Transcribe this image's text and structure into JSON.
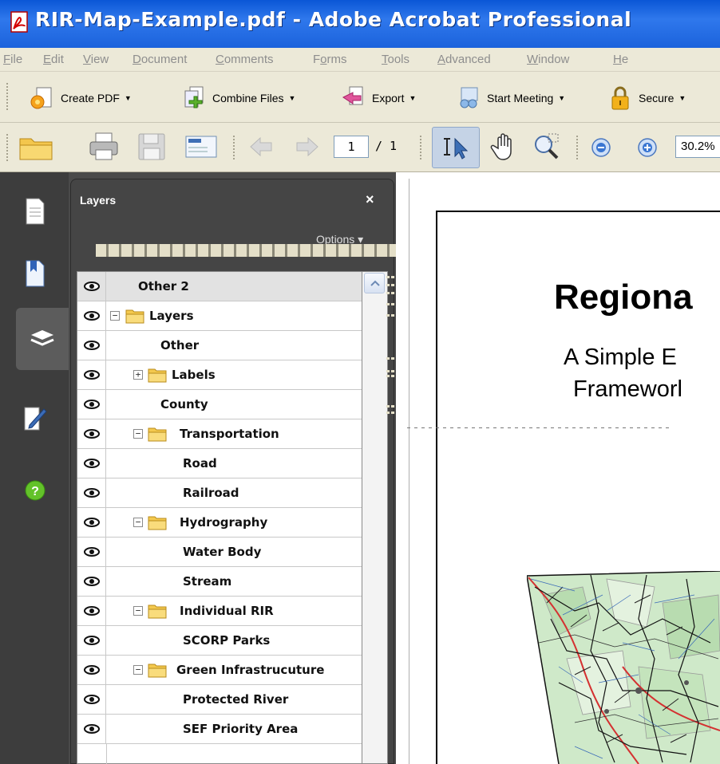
{
  "window": {
    "title": "RIR-Map-Example.pdf - Adobe Acrobat Professional"
  },
  "menu": [
    {
      "mn": "F",
      "rest": "ile"
    },
    {
      "mn": "E",
      "rest": "dit"
    },
    {
      "mn": "V",
      "rest": "iew"
    },
    {
      "mn": "D",
      "rest": "ocument"
    },
    {
      "mn": "C",
      "rest": "omments"
    },
    {
      "pre": "F",
      "mn": "o",
      "rest": "rms"
    },
    {
      "mn": "T",
      "rest": "ools"
    },
    {
      "mn": "A",
      "rest": "dvanced"
    },
    {
      "mn": "W",
      "rest": "indow"
    },
    {
      "mn": "H",
      "rest": "e"
    }
  ],
  "toolbar": {
    "create_pdf": "Create PDF",
    "combine_files": "Combine Files",
    "export": "Export",
    "start_meeting": "Start Meeting",
    "secure": "Secure"
  },
  "navigation": {
    "page_current": "1",
    "page_total": "/ 1",
    "zoom": "30.2%"
  },
  "layers_panel": {
    "title": "Layers",
    "close": "×",
    "options": "Options ▾",
    "items": [
      {
        "label": "Other 2",
        "selected": true
      },
      {
        "label": "Layers",
        "folder": true,
        "expanded": true
      },
      {
        "label": "Other"
      },
      {
        "label": "Labels",
        "folder": true,
        "expanded": false
      },
      {
        "label": "County"
      },
      {
        "label": "Transportation",
        "folder": true,
        "expanded": true
      },
      {
        "label": "Road"
      },
      {
        "label": "Railroad"
      },
      {
        "label": "Hydrography",
        "folder": true,
        "expanded": true
      },
      {
        "label": "Water Body"
      },
      {
        "label": "Stream"
      },
      {
        "label": "Individual RIR",
        "folder": true,
        "expanded": true
      },
      {
        "label": "SCORP Parks"
      },
      {
        "label": "Green Infrastrucuture",
        "folder": true,
        "expanded": true
      },
      {
        "label": "Protected River"
      },
      {
        "label": "SEF Priority Area"
      }
    ]
  },
  "document": {
    "title": "Regiona",
    "subtitle_line1": "A Simple E",
    "subtitle_line2": "Frameworl"
  },
  "icons": {
    "app": "pdf-app-icon",
    "eye": "eye-icon",
    "folder": "folder-icon"
  }
}
